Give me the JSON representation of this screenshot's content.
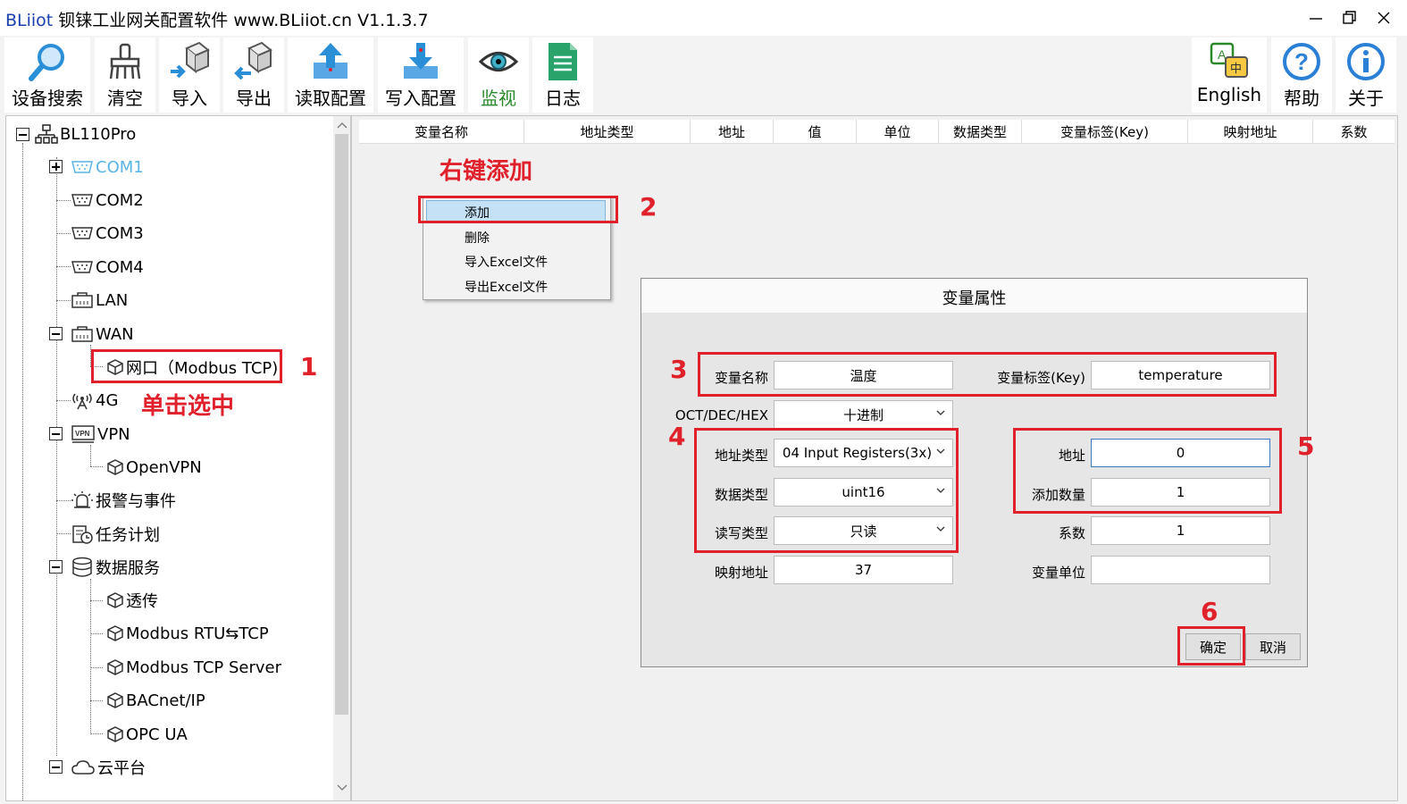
{
  "window": {
    "brand": "BLiiot",
    "title_rest": " 钡铼工业网关配置软件 www.BLiiot.cn V1.1.3.7"
  },
  "toolbar": {
    "search": "设备搜索",
    "clear": "清空",
    "import": "导入",
    "export": "导出",
    "read_config": "读取配置",
    "write_config": "写入配置",
    "monitor": "监视",
    "log": "日志",
    "english": "English",
    "help": "帮助",
    "about": "关于",
    "monitor_color": "#2a8a2a"
  },
  "tree": {
    "root": "BL110Pro",
    "com1": "COM1",
    "com2": "COM2",
    "com3": "COM3",
    "com4": "COM4",
    "lan": "LAN",
    "wan": "WAN",
    "wan_port": "网口（Modbus TCP)",
    "g4": "4G",
    "vpn": "VPN",
    "openvpn": "OpenVPN",
    "alarm": "报警与事件",
    "task": "任务计划",
    "data_service": "数据服务",
    "transparent": "透传",
    "rtu_tcp": "Modbus RTU⇆TCP",
    "tcp_server": "Modbus TCP Server",
    "bacnet": "BACnet/IP",
    "opcua": "OPC UA",
    "cloud": "云平台",
    "com1_color": "#5ab4e6"
  },
  "grid": {
    "columns": [
      "变量名称",
      "地址类型",
      "地址",
      "值",
      "单位",
      "数据类型",
      "变量标签(Key)",
      "映射地址",
      "系数"
    ]
  },
  "context_menu": {
    "add": "添加",
    "delete": "删除",
    "import_excel": "导入Excel文件",
    "export_excel": "导出Excel文件"
  },
  "dialog": {
    "title": "变量属性",
    "var_name_label": "变量名称",
    "var_name_value": "温度",
    "var_key_label": "变量标签(Key)",
    "var_key_value": "temperature",
    "radix_label": "OCT/DEC/HEX",
    "radix_value": "十进制",
    "addr_type_label": "地址类型",
    "addr_type_value": "04 Input Registers(3x)",
    "addr_label": "地址",
    "addr_value": "0",
    "data_type_label": "数据类型",
    "data_type_value": "uint16",
    "add_count_label": "添加数量",
    "add_count_value": "1",
    "rw_label": "读写类型",
    "rw_value": "只读",
    "coef_label": "系数",
    "coef_value": "1",
    "map_label": "映射地址",
    "map_value": "37",
    "unit_label": "变量单位",
    "unit_value": "",
    "ok": "确定",
    "cancel": "取消"
  },
  "annotations": {
    "n1": "1",
    "n2": "2",
    "n3": "3",
    "n4": "4",
    "n5": "5",
    "n6": "6",
    "click_select": "单击选中",
    "right_click_add": "右键添加",
    "color": "#e0202a"
  }
}
